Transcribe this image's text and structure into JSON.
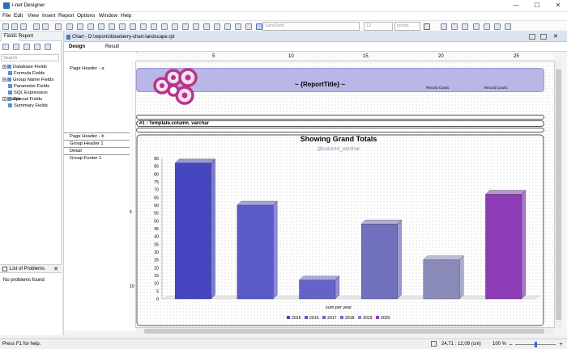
{
  "window": {
    "title": "i-net Designer",
    "minimize_glyph": "—",
    "maximize_glyph": "☐",
    "close_glyph": "✕"
  },
  "menu": [
    "File",
    "Edit",
    "View",
    "Insert",
    "Report",
    "Options",
    "Window",
    "Help"
  ],
  "toolbar": {
    "font_family": "SansSerif",
    "font_size": "12",
    "size_unit": "points"
  },
  "left_panel": {
    "tabs": [
      "Fields",
      "Report"
    ],
    "search_placeholder": "Search",
    "tree": [
      "Database Fields",
      "Formula Fields",
      "Group Name Fields",
      "Parameter Fields",
      "SQL Expression Fields",
      "Special Fields",
      "Summary Fields"
    ]
  },
  "problems": {
    "title": "List of Problems",
    "message": "No problems found",
    "close_glyph": "✕"
  },
  "document": {
    "tab_title": "Chart - D:\\reports\\blueberry-chart-landscape.rpt",
    "view_tabs": [
      "Design",
      "Result"
    ],
    "sections": [
      "Page Header - a",
      "Page Header - b",
      "Group Header 1",
      "Detail",
      "Group Footer 1"
    ],
    "report_title": "~ {ReportTitle} ~",
    "record_count_1": "Record Count:",
    "record_count_2": "Record Count:",
    "group_header_text": "#1 : Template.column_varchar"
  },
  "ruler": {
    "h_labels": [
      "5",
      "10",
      "15",
      "20",
      "25"
    ],
    "v_labels": [
      "5",
      "10"
    ]
  },
  "chart_data": {
    "type": "bar",
    "title": "Showing Grand Totals",
    "subtitle": "@column_varchar",
    "xlabel": "sum per year",
    "ylabel": "",
    "ylim": [
      0,
      90
    ],
    "yticks": [
      0,
      5,
      10,
      15,
      20,
      25,
      30,
      35,
      40,
      45,
      50,
      55,
      60,
      65,
      70,
      75,
      80,
      85,
      90
    ],
    "series": [
      {
        "name": "2015",
        "value": 87,
        "color": "#4646c0"
      },
      {
        "name": "2016",
        "value": 60,
        "color": "#5a5ac8"
      },
      {
        "name": "2017",
        "value": 12,
        "color": "#6464c8"
      },
      {
        "name": "2018",
        "value": 48,
        "color": "#7070bc"
      },
      {
        "name": "2019",
        "value": 25,
        "color": "#8a8ab8"
      },
      {
        "name": "2020",
        "value": 67,
        "color": "#8c3cb4"
      }
    ]
  },
  "status": {
    "help": "Press F1 for help.",
    "coords": "24,71 : 12,09 (cm)",
    "zoom": "100 %",
    "zoom_level": 0.5
  }
}
